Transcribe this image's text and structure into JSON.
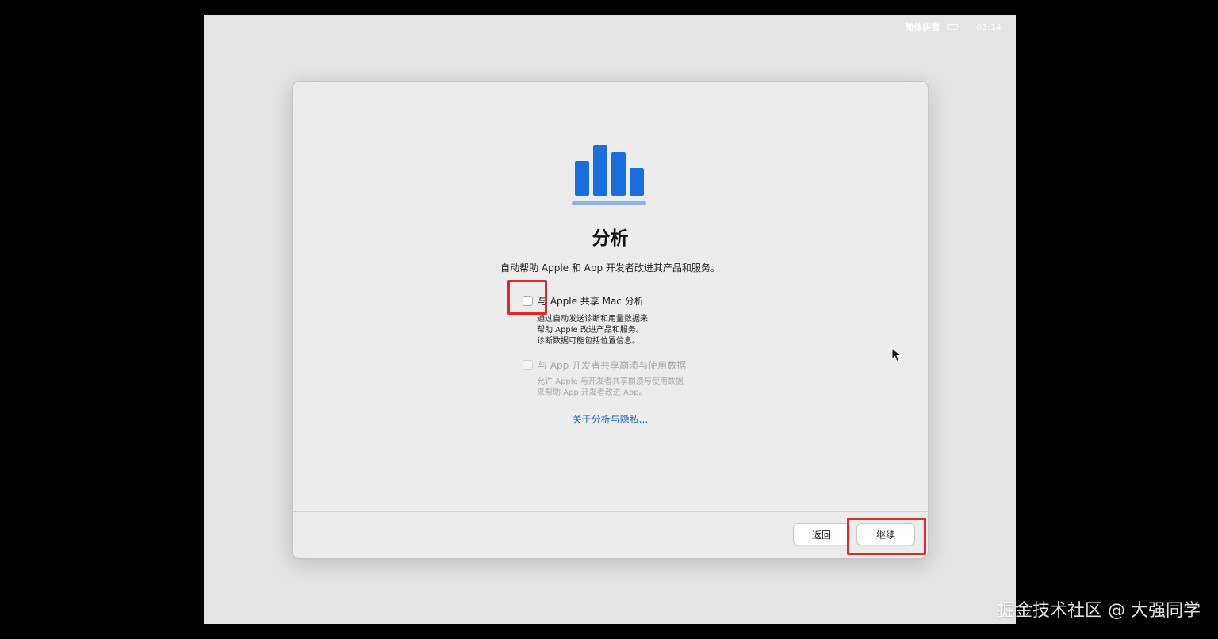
{
  "menubar": {
    "input_method": "简体拼音",
    "keyboard_icon": "keyboard-icon",
    "time": "03:14"
  },
  "setup": {
    "icon": "analytics-bar-chart-icon",
    "icon_color": "#1a6fde",
    "title": "分析",
    "subtitle": "自动帮助 Apple 和 App 开发者改进其产品和服务。",
    "options": [
      {
        "label": "与 Apple 共享 Mac 分析",
        "checked": false,
        "enabled": true,
        "description": "通过自动发送诊断和用量数据来\n帮助 Apple 改进产品和服务。\n诊断数据可能包括位置信息。"
      },
      {
        "label": "与 App 开发者共享崩溃与使用数据",
        "checked": false,
        "enabled": false,
        "description": "允许 Apple 与开发者共享崩溃与使用数据\n来帮助 App 开发者改进 App。"
      }
    ],
    "privacy_link": "关于分析与隐私..."
  },
  "footer": {
    "back_label": "返回",
    "continue_label": "继续"
  },
  "annotations": {
    "highlight_color": "#e02a2a"
  },
  "watermark": "掘金技术社区 @ 大强同学"
}
